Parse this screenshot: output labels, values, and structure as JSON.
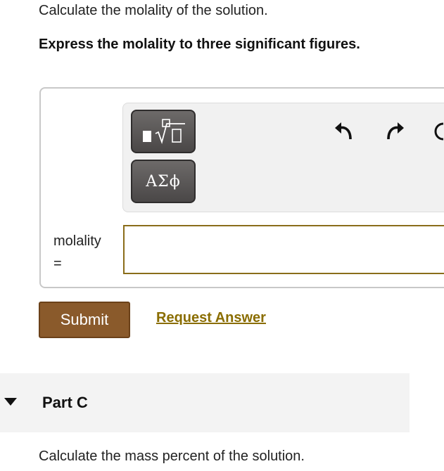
{
  "question": "Calculate the molality of the solution.",
  "instruction": "Express the molality to three significant figures.",
  "toolbar": {
    "math_templates_icon": "fraction-root-icon",
    "greek_symbols_label": "ΑΣϕ",
    "undo_icon": "undo-icon",
    "redo_icon": "redo-icon",
    "reset_icon": "reset-icon"
  },
  "answer": {
    "label": "molality",
    "equals": "=",
    "value": ""
  },
  "actions": {
    "submit_label": "Submit",
    "request_answer_label": "Request Answer"
  },
  "part_c": {
    "title": "Part C",
    "question": "Calculate the mass percent of the solution."
  },
  "colors": {
    "submit_bg": "#8a5a2b",
    "link": "#8a6d00",
    "input_border": "#8a6d1a"
  }
}
